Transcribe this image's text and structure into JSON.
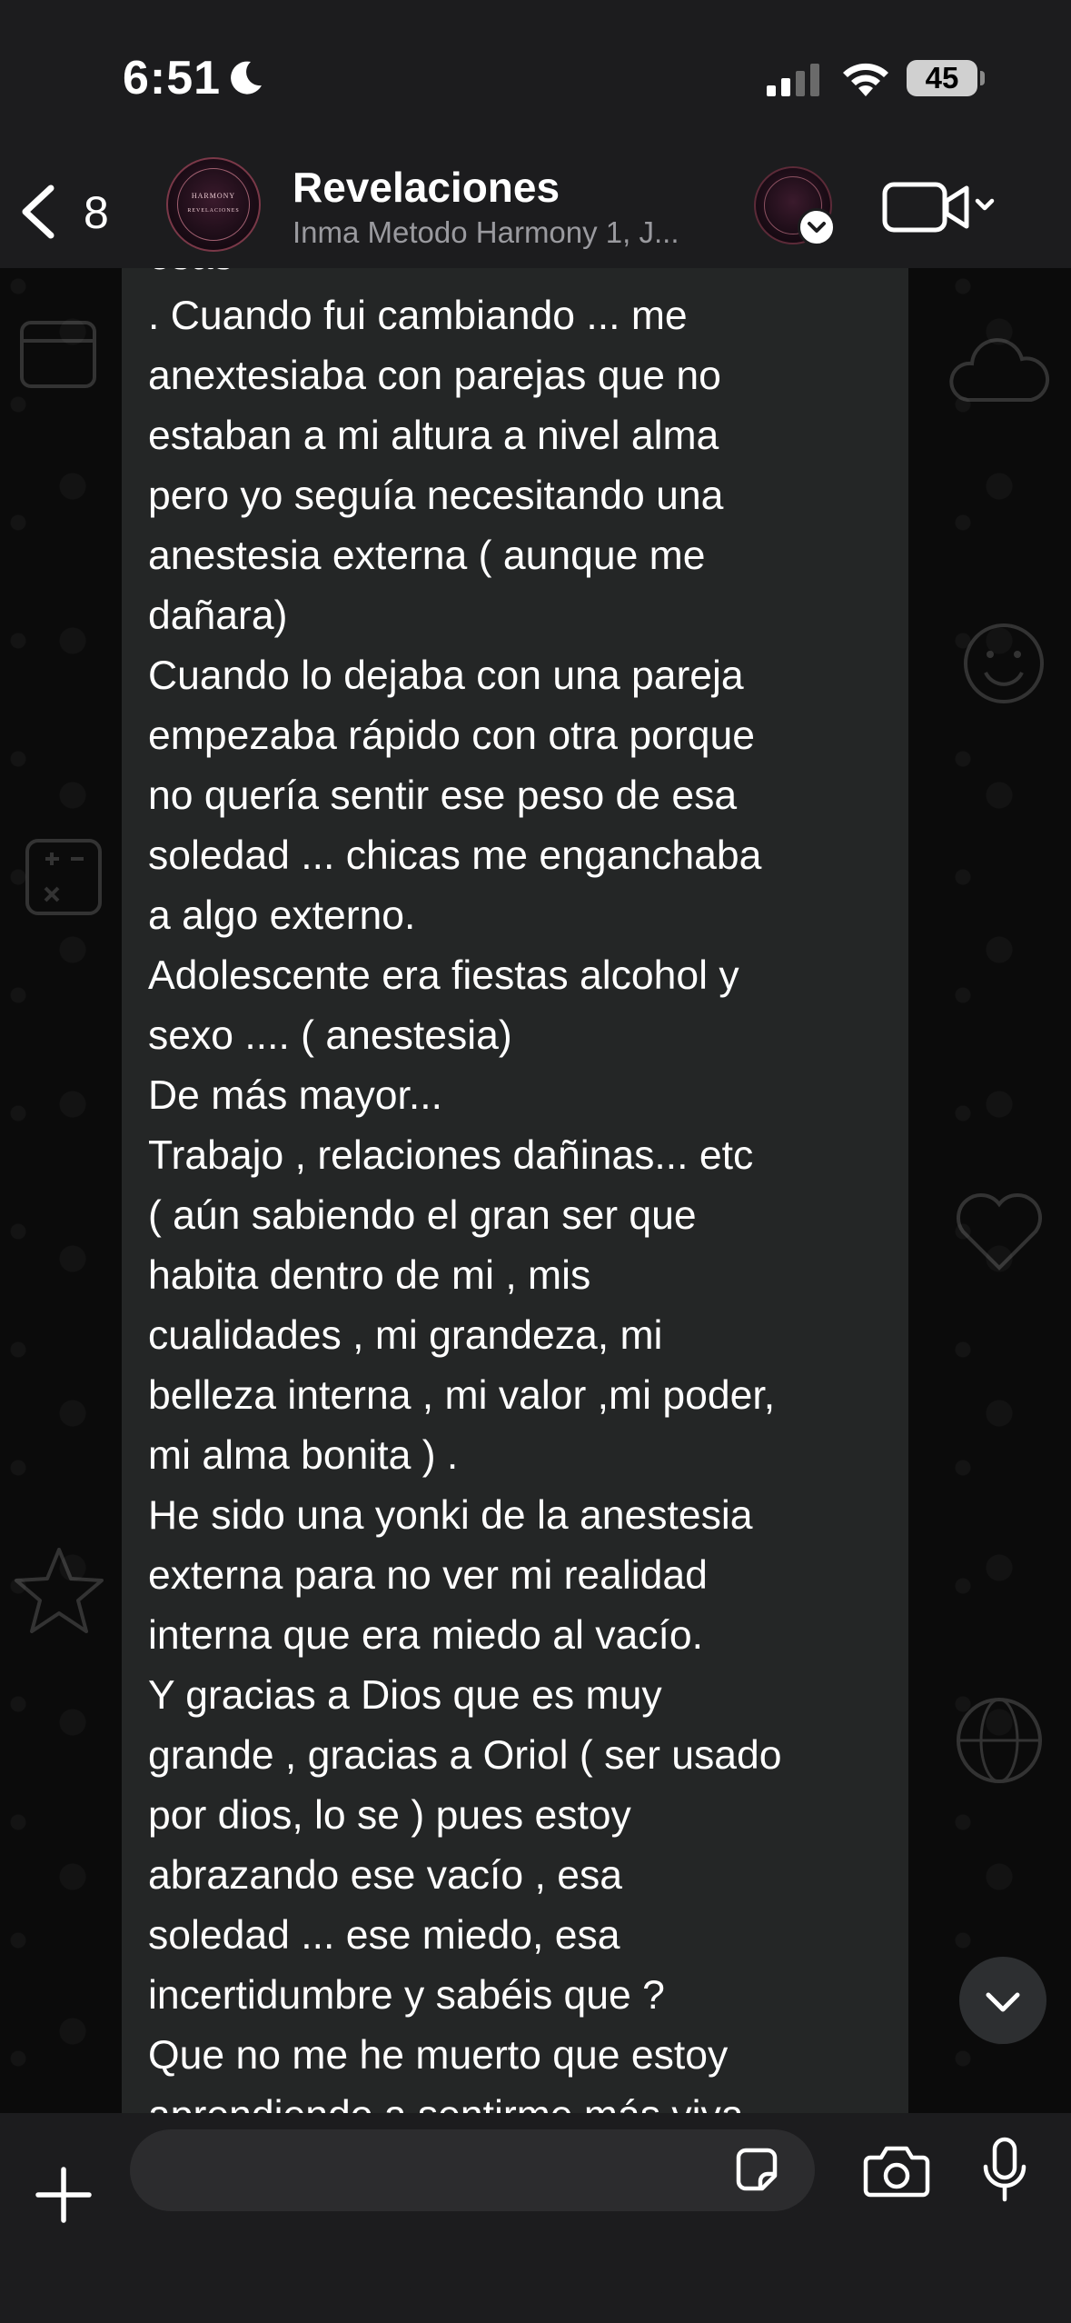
{
  "status_bar": {
    "time": "6:51",
    "battery": "45"
  },
  "header": {
    "back_count": "8",
    "title": "Revelaciones",
    "subtitle": "Inma Metodo Harmony 1, J...",
    "avatar_brand": "HARMONY",
    "avatar_brand_sub": "REVELACIONES"
  },
  "message": {
    "lines": [
      "esas",
      ". Cuando fui cambiando ... me",
      "anextesiaba con parejas que no",
      "estaban a mi altura a nivel alma",
      "pero yo seguía necesitando una",
      "anestesia externa ( aunque me",
      "dañara)",
      "Cuando lo dejaba con una pareja",
      "empezaba rápido con otra porque",
      "no quería sentir ese peso de esa",
      "soledad ... chicas me enganchaba",
      "a algo externo.",
      "Adolescente era fiestas alcohol y",
      "sexo .... ( anestesia)",
      "De más mayor...",
      "Trabajo , relaciones dañinas... etc",
      "( aún sabiendo el gran ser que",
      "habita dentro de mi , mis",
      "cualidades , mi grandeza, mi",
      "belleza interna , mi valor ,mi poder,",
      "mi alma bonita ) .",
      "He sido una yonki de la anestesia",
      "externa para no ver mi realidad",
      "interna que era miedo al vacío.",
      "Y gracias a Dios que es muy",
      "grande , gracias a Oriol ( ser usado",
      "por dios, lo se ) pues estoy",
      "abrazando ese vacío , esa",
      "soledad ... ese miedo, esa",
      "incertidumbre y sabéis que ?",
      "Que no me he muerto que estoy",
      "aprendiendo a sentirme más viva"
    ]
  },
  "input": {
    "placeholder": "",
    "value": ""
  },
  "colors": {
    "bar_background": "#1c1c1e",
    "bubble_background": "#242626",
    "chat_background": "#0b0b0b"
  },
  "icons": [
    "moon-icon",
    "signal-icon",
    "wifi-icon",
    "back-chevron-icon",
    "video-camera-icon",
    "plus-icon",
    "sticker-icon",
    "camera-icon",
    "microphone-icon",
    "chevron-down-icon"
  ]
}
